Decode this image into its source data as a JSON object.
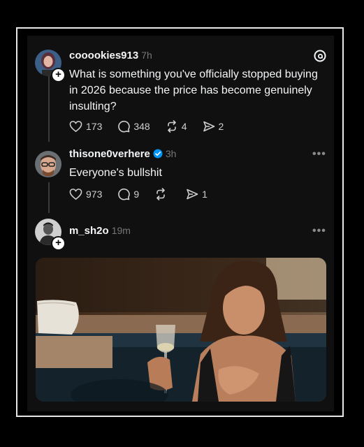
{
  "posts": [
    {
      "username": "cooookies913",
      "time": "7h",
      "text": "What is something you've officially stopped buying in 2026 because the price has become genuinely insulting?",
      "likes": "173",
      "replies": "348",
      "reposts": "4",
      "shares": "2",
      "corner_icon": "threads-logo-icon"
    },
    {
      "username": "thisone0verhere",
      "verified": true,
      "time": "3h",
      "text": "Everyone's bullshit",
      "likes": "973",
      "replies": "9",
      "reposts": "",
      "shares": "1",
      "more_label": "•••"
    },
    {
      "username": "m_sh2o",
      "time": "19m",
      "more_label": "•••",
      "media": "gif-woman-holding-wine-glass"
    }
  ],
  "badge_plus": "+",
  "colors": {
    "background": "#101010",
    "text": "#f3f5f7",
    "muted": "#777777",
    "verified": "#0095f6",
    "frame": "#e8e8e8"
  }
}
